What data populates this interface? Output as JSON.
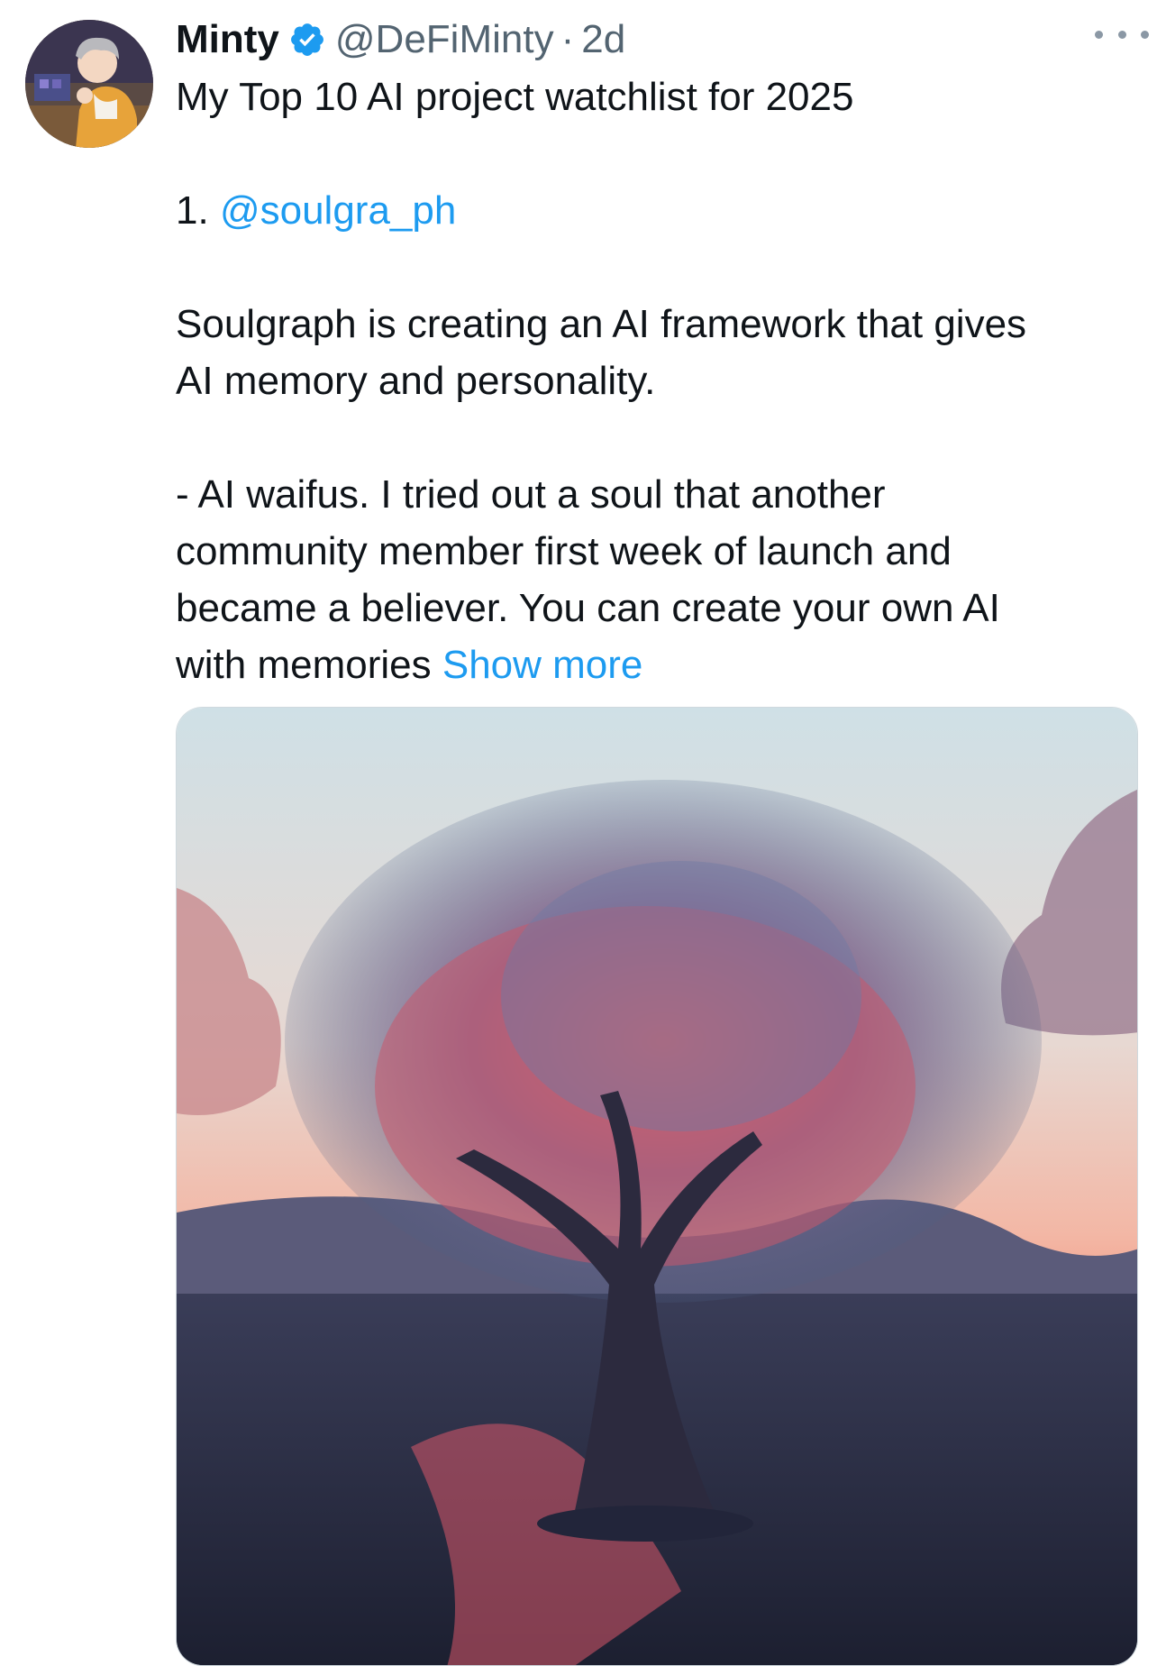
{
  "tweet": {
    "author": {
      "display_name": "Minty",
      "handle": "@DeFiMinty",
      "separator": "·",
      "time": "2d",
      "verified": true,
      "avatar_icon": "avatar-illustration"
    },
    "more_icon": "more-horizontal-icon",
    "text": {
      "line1": "My Top 10 AI project watchlist for 2025",
      "item_number": "1.",
      "mention": "@soulgra_ph",
      "para1_line1": "Soulgraph is creating an AI framework that gives",
      "para1_line2": "AI memory and personality.",
      "para2_line1": "- AI waifus. I tried out a soul that another",
      "para2_line2": "community member first week of launch and",
      "para2_line3": "became a believer. You can create your own AI",
      "para2_line4_prefix": "with memories",
      "show_more": "Show more"
    },
    "media": {
      "type": "image"
    }
  },
  "colors": {
    "text": "#0f1419",
    "secondary": "#536471",
    "link": "#1d9bf0",
    "verified": "#1d9bf0"
  }
}
